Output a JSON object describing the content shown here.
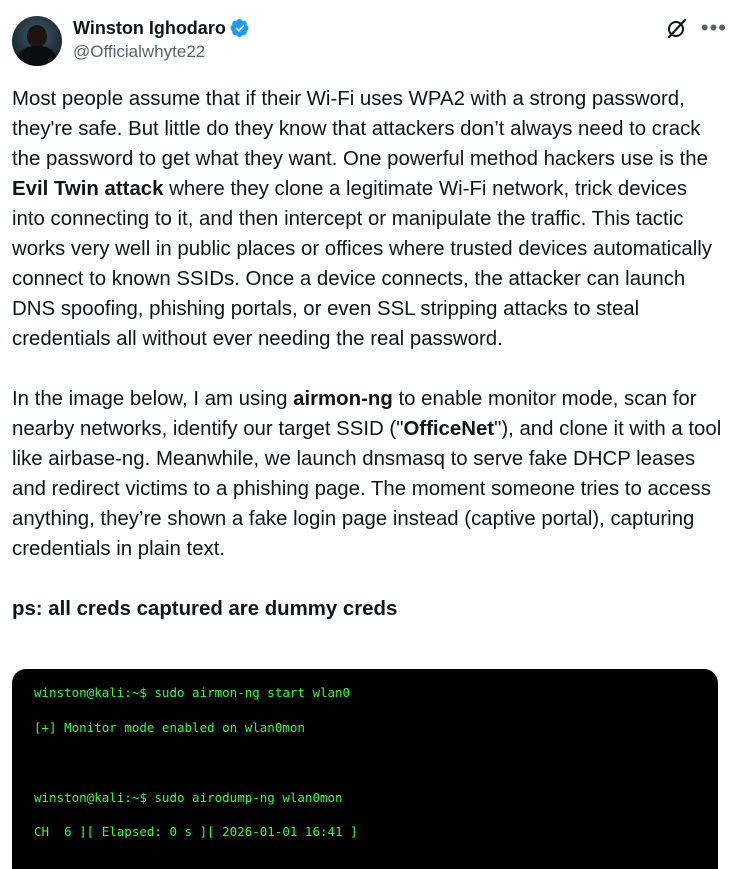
{
  "author": {
    "name": "Winston Ighodaro",
    "handle": "@Officialwhyte22"
  },
  "icons": {
    "verified": "verified-badge-icon",
    "grok": "grok-icon",
    "more": "more-options-icon"
  },
  "colors": {
    "verified_blue": "#1d9bf0",
    "text": "#0f1419",
    "secondary": "#536471",
    "terminal_bg": "#000000",
    "terminal_green": "#33ff33"
  },
  "tweet": {
    "p1": {
      "t1": "Most people assume that if their Wi-Fi uses WPA2 with a strong password, they're safe. But little do they know that attackers don’t always need to crack the password to get what they want. One powerful method hackers use is the ",
      "b1": "Evil Twin attack",
      "t2": " where they clone a legitimate Wi-Fi network, trick devices into connecting to it, and then intercept or manipulate the traffic. This tactic works very well in public places or offices where trusted devices automatically connect to known SSIDs. Once a device connects, the attacker can launch DNS spoofing, phishing portals, or even SSL stripping attacks to steal credentials all without ever needing the real password."
    },
    "p2": {
      "t1": "In the image below, I am using ",
      "b1": "airmon-ng",
      "t2": " to enable monitor mode, scan for nearby networks, identify our target SSID (\"",
      "b2": "OfficeNet",
      "t3": "\"), and clone it with a tool like airbase-ng. Meanwhile, we launch dnsmasq to serve fake DHCP leases and redirect victims to a phishing page. The moment someone tries to access anything, they’re shown a fake login page instead (captive portal), capturing credentials in plain text."
    },
    "p3": "ps: all creds captured are dummy creds"
  },
  "terminal": {
    "line1": "winston@kali:~$ sudo airmon-ng start wlan0",
    "line2": "[+] Monitor mode enabled on wlan0mon",
    "line3": "winston@kali:~$ sudo airodump-ng wlan0mon",
    "line4": "CH  6 ][ Elapsed: 0 s ][ 2026-01-01 16:41 ]"
  }
}
